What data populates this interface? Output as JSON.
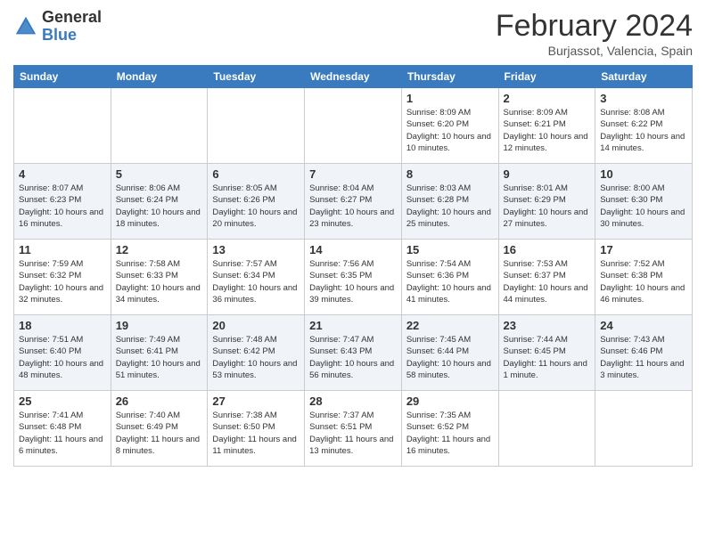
{
  "header": {
    "logo_general": "General",
    "logo_blue": "Blue",
    "month_title": "February 2024",
    "location": "Burjassot, Valencia, Spain"
  },
  "days_of_week": [
    "Sunday",
    "Monday",
    "Tuesday",
    "Wednesday",
    "Thursday",
    "Friday",
    "Saturday"
  ],
  "weeks": [
    [
      {
        "date": "",
        "info": ""
      },
      {
        "date": "",
        "info": ""
      },
      {
        "date": "",
        "info": ""
      },
      {
        "date": "",
        "info": ""
      },
      {
        "date": "1",
        "info": "Sunrise: 8:09 AM\nSunset: 6:20 PM\nDaylight: 10 hours and 10 minutes."
      },
      {
        "date": "2",
        "info": "Sunrise: 8:09 AM\nSunset: 6:21 PM\nDaylight: 10 hours and 12 minutes."
      },
      {
        "date": "3",
        "info": "Sunrise: 8:08 AM\nSunset: 6:22 PM\nDaylight: 10 hours and 14 minutes."
      }
    ],
    [
      {
        "date": "4",
        "info": "Sunrise: 8:07 AM\nSunset: 6:23 PM\nDaylight: 10 hours and 16 minutes."
      },
      {
        "date": "5",
        "info": "Sunrise: 8:06 AM\nSunset: 6:24 PM\nDaylight: 10 hours and 18 minutes."
      },
      {
        "date": "6",
        "info": "Sunrise: 8:05 AM\nSunset: 6:26 PM\nDaylight: 10 hours and 20 minutes."
      },
      {
        "date": "7",
        "info": "Sunrise: 8:04 AM\nSunset: 6:27 PM\nDaylight: 10 hours and 23 minutes."
      },
      {
        "date": "8",
        "info": "Sunrise: 8:03 AM\nSunset: 6:28 PM\nDaylight: 10 hours and 25 minutes."
      },
      {
        "date": "9",
        "info": "Sunrise: 8:01 AM\nSunset: 6:29 PM\nDaylight: 10 hours and 27 minutes."
      },
      {
        "date": "10",
        "info": "Sunrise: 8:00 AM\nSunset: 6:30 PM\nDaylight: 10 hours and 30 minutes."
      }
    ],
    [
      {
        "date": "11",
        "info": "Sunrise: 7:59 AM\nSunset: 6:32 PM\nDaylight: 10 hours and 32 minutes."
      },
      {
        "date": "12",
        "info": "Sunrise: 7:58 AM\nSunset: 6:33 PM\nDaylight: 10 hours and 34 minutes."
      },
      {
        "date": "13",
        "info": "Sunrise: 7:57 AM\nSunset: 6:34 PM\nDaylight: 10 hours and 36 minutes."
      },
      {
        "date": "14",
        "info": "Sunrise: 7:56 AM\nSunset: 6:35 PM\nDaylight: 10 hours and 39 minutes."
      },
      {
        "date": "15",
        "info": "Sunrise: 7:54 AM\nSunset: 6:36 PM\nDaylight: 10 hours and 41 minutes."
      },
      {
        "date": "16",
        "info": "Sunrise: 7:53 AM\nSunset: 6:37 PM\nDaylight: 10 hours and 44 minutes."
      },
      {
        "date": "17",
        "info": "Sunrise: 7:52 AM\nSunset: 6:38 PM\nDaylight: 10 hours and 46 minutes."
      }
    ],
    [
      {
        "date": "18",
        "info": "Sunrise: 7:51 AM\nSunset: 6:40 PM\nDaylight: 10 hours and 48 minutes."
      },
      {
        "date": "19",
        "info": "Sunrise: 7:49 AM\nSunset: 6:41 PM\nDaylight: 10 hours and 51 minutes."
      },
      {
        "date": "20",
        "info": "Sunrise: 7:48 AM\nSunset: 6:42 PM\nDaylight: 10 hours and 53 minutes."
      },
      {
        "date": "21",
        "info": "Sunrise: 7:47 AM\nSunset: 6:43 PM\nDaylight: 10 hours and 56 minutes."
      },
      {
        "date": "22",
        "info": "Sunrise: 7:45 AM\nSunset: 6:44 PM\nDaylight: 10 hours and 58 minutes."
      },
      {
        "date": "23",
        "info": "Sunrise: 7:44 AM\nSunset: 6:45 PM\nDaylight: 11 hours and 1 minute."
      },
      {
        "date": "24",
        "info": "Sunrise: 7:43 AM\nSunset: 6:46 PM\nDaylight: 11 hours and 3 minutes."
      }
    ],
    [
      {
        "date": "25",
        "info": "Sunrise: 7:41 AM\nSunset: 6:48 PM\nDaylight: 11 hours and 6 minutes."
      },
      {
        "date": "26",
        "info": "Sunrise: 7:40 AM\nSunset: 6:49 PM\nDaylight: 11 hours and 8 minutes."
      },
      {
        "date": "27",
        "info": "Sunrise: 7:38 AM\nSunset: 6:50 PM\nDaylight: 11 hours and 11 minutes."
      },
      {
        "date": "28",
        "info": "Sunrise: 7:37 AM\nSunset: 6:51 PM\nDaylight: 11 hours and 13 minutes."
      },
      {
        "date": "29",
        "info": "Sunrise: 7:35 AM\nSunset: 6:52 PM\nDaylight: 11 hours and 16 minutes."
      },
      {
        "date": "",
        "info": ""
      },
      {
        "date": "",
        "info": ""
      }
    ]
  ]
}
